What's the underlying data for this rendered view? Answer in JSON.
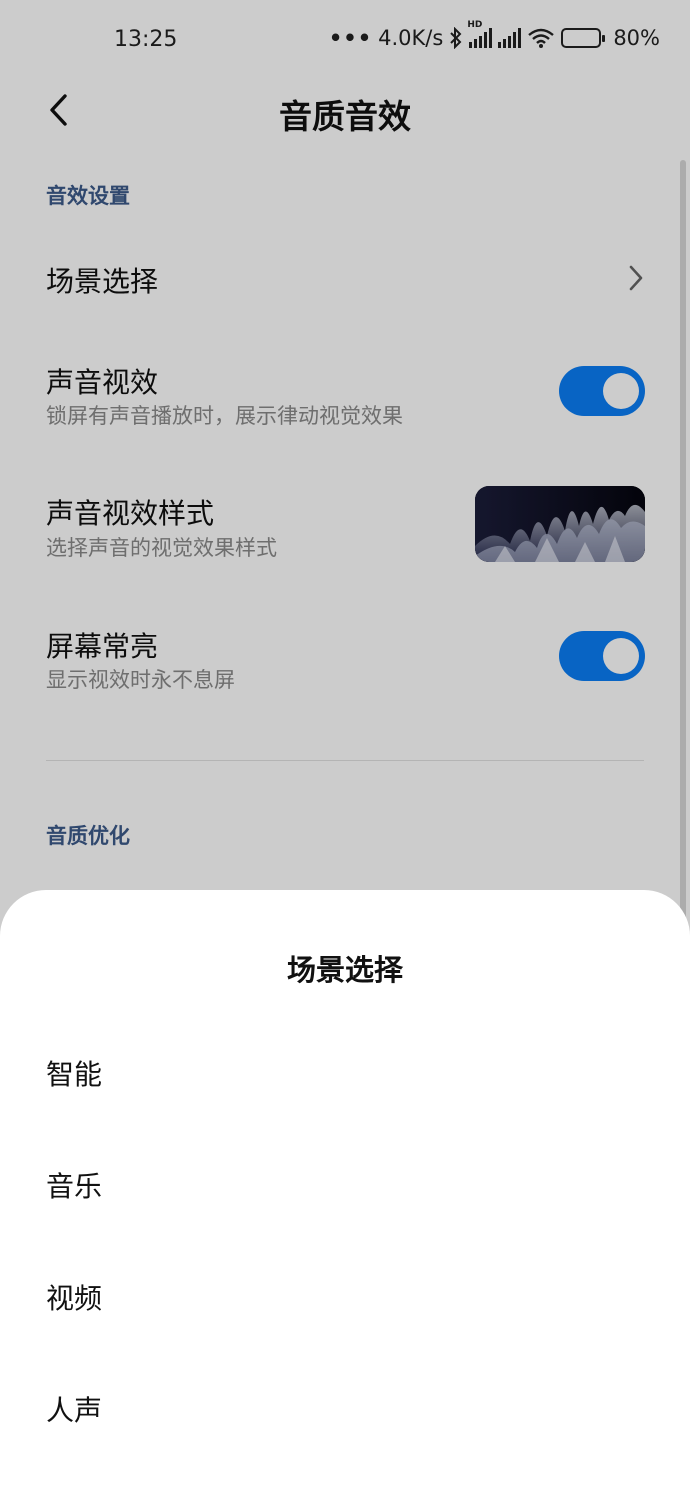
{
  "status_bar": {
    "time": "13:25",
    "dots": "•••",
    "net_speed": "4.0K/s",
    "hd_label": "HD",
    "battery": "80%",
    "battery_level": 0.8
  },
  "header": {
    "back_icon": "chevron-left-icon",
    "title": "音质音效"
  },
  "sections": {
    "effects_header": "音效设置",
    "quality_header": "音质优化"
  },
  "rows": {
    "scene": {
      "title": "场景选择",
      "icon": "chevron-right-icon"
    },
    "visual": {
      "title": "声音视效",
      "subtitle": "锁屏有声音播放时，展示律动视觉效果",
      "enabled": true
    },
    "style": {
      "title": "声音视效样式",
      "subtitle": "选择声音的视觉效果样式"
    },
    "keep_on": {
      "title": "屏幕常亮",
      "subtitle": "显示视效时永不息屏",
      "enabled": true
    }
  },
  "sheet": {
    "title": "场景选择",
    "options": [
      {
        "label": "智能"
      },
      {
        "label": "音乐"
      },
      {
        "label": "视频"
      },
      {
        "label": "人声"
      }
    ]
  },
  "colors": {
    "accent": "#0A7EF5",
    "section_header": "#3D5A8A",
    "subtitle": "#8A8A8A",
    "scrim": "rgba(0,0,0,0.2)"
  }
}
